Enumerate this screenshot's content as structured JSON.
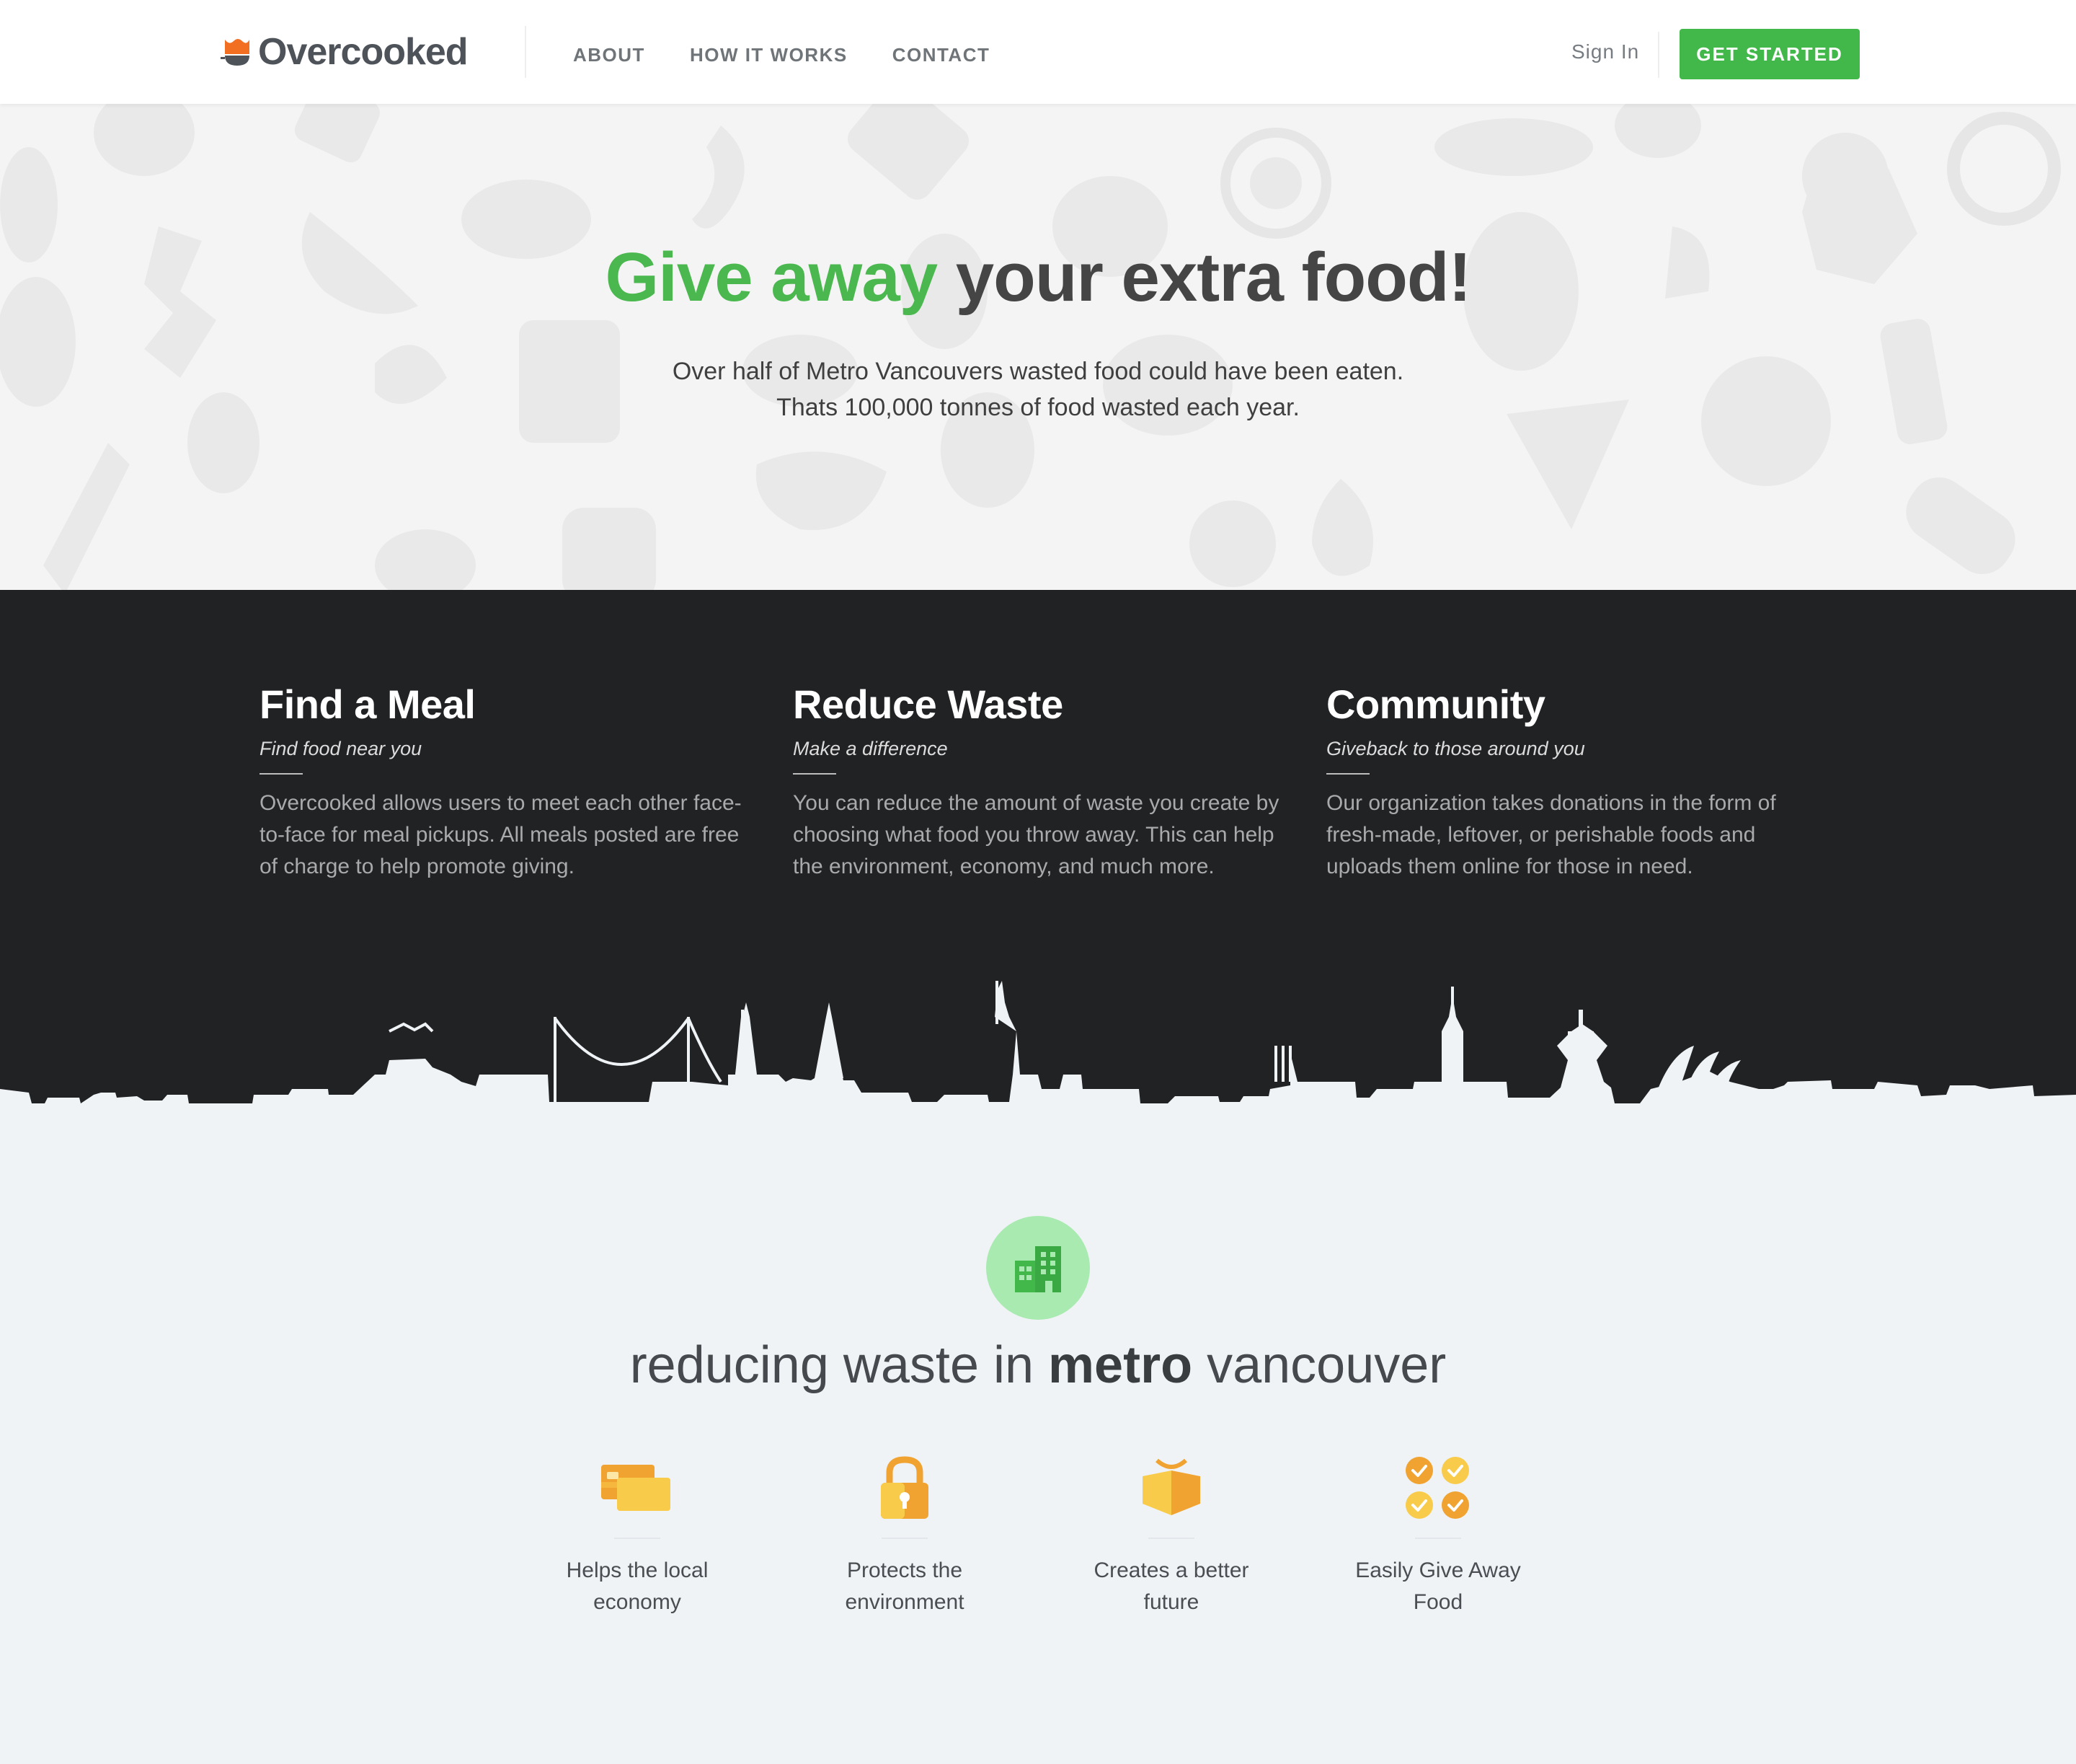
{
  "nav": {
    "logo_text": "Overcooked",
    "links": [
      "ABOUT",
      "HOW IT WORKS",
      "CONTACT"
    ],
    "sign_in": "Sign In",
    "cta": "GET STARTED"
  },
  "hero": {
    "title_green": "Give away",
    "title_rest": " your extra food!",
    "subtitle_line1": "Over half of Metro Vancouvers wasted food could have been eaten.",
    "subtitle_line2": "Thats 100,000 tonnes of food wasted each year."
  },
  "features": [
    {
      "title": "Find a Meal",
      "tagline": "Find food near you",
      "body": "Overcooked allows users to meet each other face-to-face for meal pickups. All meals posted are free of charge to help promote giving."
    },
    {
      "title": "Reduce Waste",
      "tagline": "Make a difference",
      "body": "You can reduce the amount of waste you create by choosing what food you throw away. This can help the environment, economy, and much more."
    },
    {
      "title": "Community",
      "tagline": "Giveback to those around you",
      "body": "Our organization takes donations in the form of fresh-made, leftover, or perishable foods and uploads them online for those in need."
    }
  ],
  "mission": {
    "prefix": "reducing waste in ",
    "bold": "metro",
    "suffix": " vancouver",
    "icon": "building-icon"
  },
  "benefits": [
    {
      "icon": "credit-card-icon",
      "label": "Helps the local economy"
    },
    {
      "icon": "lock-icon",
      "label": "Protects the environment"
    },
    {
      "icon": "open-box-icon",
      "label": "Creates a better future"
    },
    {
      "icon": "checklist-icon",
      "label": "Easily Give Away Food"
    }
  ],
  "colors": {
    "brand_green": "#43b84a",
    "dark_section": "#212224",
    "icon_orange": "#f0a330",
    "icon_yellow": "#f9cb4a"
  }
}
